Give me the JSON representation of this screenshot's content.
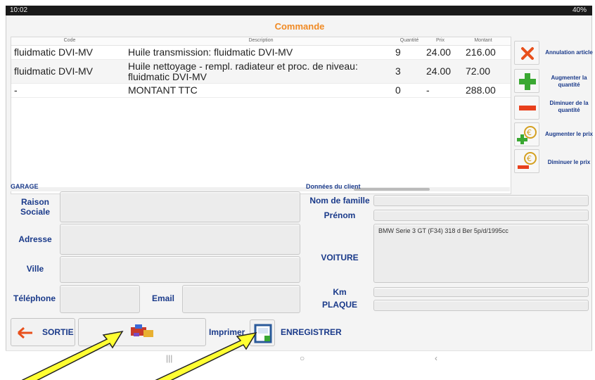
{
  "status_bar": {
    "time": "10:02",
    "right": "40%"
  },
  "title": "Commande",
  "table": {
    "columns": [
      "Code",
      "Description",
      "Quantité",
      "Prix",
      "Montant"
    ],
    "rows": [
      {
        "code": "fluidmatic DVI-MV",
        "description": "Huile transmission: fluidmatic DVI-MV",
        "quantite": "9",
        "prix": "24.00",
        "montant": "216.00"
      },
      {
        "code": "fluidmatic DVI-MV",
        "description": "Huile nettoyage - rempl. radiateur et proc. de niveau: fluidmatic DVI-MV",
        "quantite": "3",
        "prix": "24.00",
        "montant": "72.00"
      },
      {
        "code": "-",
        "description": "MONTANT TTC",
        "quantite": "0",
        "prix": "-",
        "montant": "288.00"
      }
    ]
  },
  "actions": {
    "annulation": "Annulation article",
    "augmenter_qte": "Augmenter la quantité",
    "diminuer_qte": "Diminuer de la quantité",
    "augmenter_prix": "Augmenter le prix",
    "diminuer_prix": "Diminuer le prix"
  },
  "garage": {
    "section": "GARAGE",
    "raison_sociale": "Raison Sociale",
    "adresse": "Adresse",
    "ville": "Ville",
    "telephone": "Téléphone",
    "email": "Email"
  },
  "client": {
    "section": "Données du client",
    "nom": "Nom de famille",
    "prenom": "Prénom",
    "voiture": "VOITURE",
    "voiture_value": "BMW Serie 3 GT (F34) 318 d Ber 5p/d/1995cc",
    "km": "Km",
    "plaque": "PLAQUE"
  },
  "footer": {
    "sortie": "SORTIE",
    "imprimer": "Imprimer",
    "enregistrer": "ENREGISTRER"
  },
  "colors": {
    "accent": "#f08a24",
    "label": "#1a3a8a",
    "annotation": "#ffff33"
  }
}
